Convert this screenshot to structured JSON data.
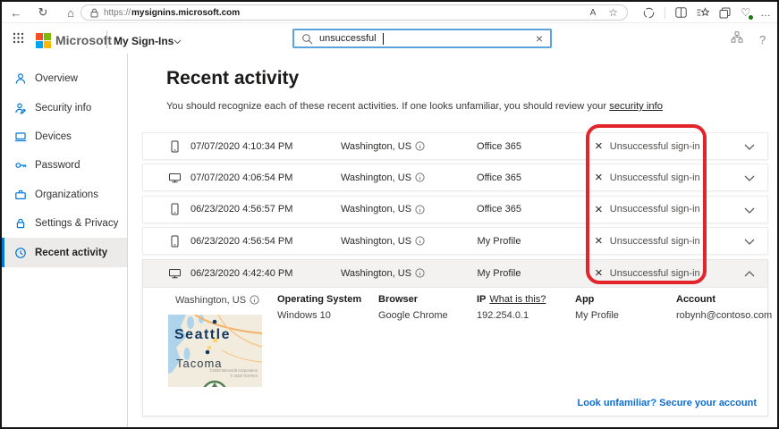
{
  "browser": {
    "url_scheme": "https://",
    "url_domain": "mysignins.microsoft.com",
    "icons": {
      "back": "←",
      "refresh": "↻",
      "home": "⌂",
      "read_aloud": "A",
      "favorite": "☆",
      "essentials": "♡",
      "more": "…"
    }
  },
  "header": {
    "brand": "Microsoft",
    "app_title": "My Sign-Ins",
    "search_value": "unsuccessful",
    "clear": "×",
    "help": "?"
  },
  "sidebar": {
    "items": [
      {
        "label": "Overview"
      },
      {
        "label": "Security info"
      },
      {
        "label": "Devices"
      },
      {
        "label": "Password"
      },
      {
        "label": "Organizations"
      },
      {
        "label": "Settings & Privacy"
      },
      {
        "label": "Recent activity"
      }
    ]
  },
  "main": {
    "title": "Recent activity",
    "subtitle": "You should recognize each of these recent activities. If one looks unfamiliar, you should review your ",
    "subtitle_link": "security info",
    "status_x": "×",
    "rows": [
      {
        "device": "mobile",
        "datetime": "07/07/2020 4:10:34 PM",
        "location": "Washington, US",
        "app": "Office 365",
        "status": "Unsuccessful sign-in"
      },
      {
        "device": "desktop",
        "datetime": "07/07/2020 4:06:54 PM",
        "location": "Washington, US",
        "app": "Office 365",
        "status": "Unsuccessful sign-in"
      },
      {
        "device": "mobile",
        "datetime": "06/23/2020 4:56:57 PM",
        "location": "Washington, US",
        "app": "Office 365",
        "status": "Unsuccessful sign-in"
      },
      {
        "device": "mobile",
        "datetime": "06/23/2020 4:56:54 PM",
        "location": "Washington, US",
        "app": "My Profile",
        "status": "Unsuccessful sign-in"
      },
      {
        "device": "desktop",
        "datetime": "06/23/2020 4:42:40 PM",
        "location": "Washington, US",
        "app": "My Profile",
        "status": "Unsuccessful sign-in"
      }
    ],
    "details": {
      "location": "Washington, US",
      "map_city_1": "Seattle",
      "map_city_2": "Tacoma",
      "map_attribution_1": "©2020 Microsoft Corporation",
      "map_attribution_2": "© 2020 TomTom",
      "os_label": "Operating System",
      "os_value": "Windows 10",
      "browser_label": "Browser",
      "browser_value": "Google Chrome",
      "ip_label": "IP",
      "ip_link": "What is this?",
      "ip_value": "192.254.0.1",
      "app_label": "App",
      "app_value": "My Profile",
      "account_label": "Account",
      "account_value": "robynh@contoso.com"
    },
    "footer_link": "Look unfamiliar? Secure your account"
  },
  "colors": {
    "accent": "#0078d4",
    "annotation": "#e2242b",
    "link": "#0b6cd4"
  }
}
